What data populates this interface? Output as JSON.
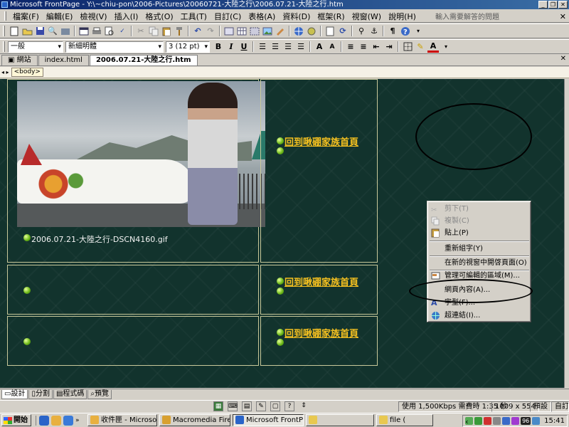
{
  "window": {
    "title": "Microsoft FrontPage - Y:\\~chiu-pon\\2006-Pictures\\20060721-大陸之行\\2006.07.21-大陸之行.htm"
  },
  "menubar": {
    "items": [
      "檔案(F)",
      "編輯(E)",
      "檢視(V)",
      "插入(I)",
      "格式(O)",
      "工具(T)",
      "目訂(C)",
      "表格(A)",
      "資料(D)",
      "框架(R)",
      "視窗(W)",
      "說明(H)"
    ],
    "help_placeholder": "輸入需要解答的問題",
    "close_glyph": "✕"
  },
  "format_toolbar": {
    "style": "一般",
    "font": "新細明體",
    "size": "3  (12 pt)",
    "bold": "B",
    "italic": "I",
    "underline": "U",
    "grow_font": "A",
    "shrink_font": "A",
    "font_color": "A"
  },
  "tabs": [
    "網站",
    "index.html",
    "2006.07.21-大陸之行.htm"
  ],
  "tag_selector": "<body>",
  "editor": {
    "photo_caption": "2006.07.21-大陸之行-DSCN4160.gif",
    "home_link": "回到啾硼家族首頁"
  },
  "context_menu": {
    "items": [
      {
        "label": "剪下(T)",
        "icon": "cut-icon",
        "disabled": true
      },
      {
        "label": "複製(C)",
        "icon": "copy-icon",
        "disabled": true
      },
      {
        "label": "貼上(P)",
        "icon": "paste-icon",
        "disabled": false
      },
      {
        "label": "重新組字(Y)",
        "icon": "",
        "disabled": false
      },
      {
        "label": "在新的視窗中開啓頁面(O)",
        "icon": "",
        "disabled": false
      },
      {
        "label": "管理可編輯的區域(M)...",
        "icon": "editable-region-icon",
        "disabled": false
      },
      {
        "label": "網頁內容(A)...",
        "icon": "",
        "disabled": false
      },
      {
        "label": "字型(F)...",
        "icon": "font-icon",
        "disabled": false
      },
      {
        "label": "超連結(I)...",
        "icon": "hyperlink-icon",
        "disabled": false
      }
    ]
  },
  "view_tabs": [
    "設計",
    "分割",
    "程式碼",
    "預覽"
  ],
  "status": {
    "download": "使用 1,500Kbps 需費時 1:35 秒",
    "size": "1009 x 554",
    "mode": "預設",
    "custom": "自訂"
  },
  "taskbar": {
    "start": "開始",
    "tasks": [
      "收件匣 - Microsoft ...",
      "Macromedia Firewo...",
      "Microsoft FrontPage...",
      "",
      "file ("
    ],
    "tray_number": "96",
    "clock": "15:41"
  },
  "colors": {
    "editor_bg": "#12332d",
    "link_color": "#f4c020",
    "cell_border": "#c8c89a"
  }
}
